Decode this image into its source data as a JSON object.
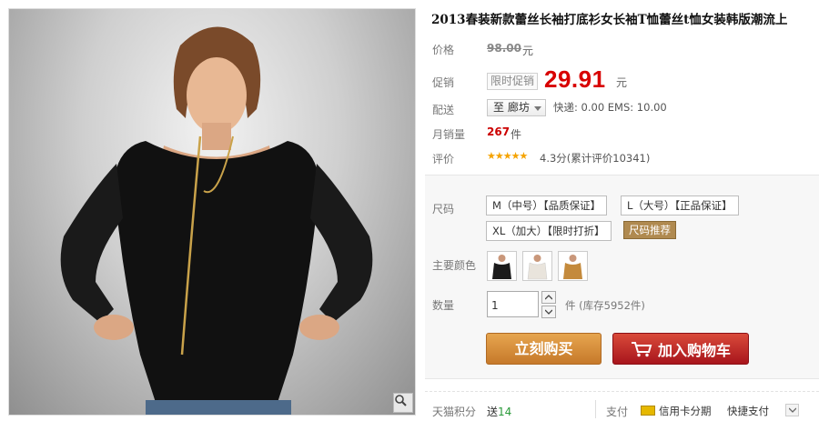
{
  "product": {
    "title": "2013春装新款蕾丝长袖打底衫女长袖T恤蕾丝t恤女装韩版潮流上"
  },
  "price": {
    "label": "价格",
    "original": "98.00",
    "unit": "元"
  },
  "promo": {
    "label": "促销",
    "tag": "限时促销",
    "price": "29.91",
    "unit": "元"
  },
  "delivery": {
    "label": "配送",
    "location": "至 廊坊",
    "shipping": "快递: 0.00 EMS: 10.00"
  },
  "sales": {
    "label": "月销量",
    "count": "267",
    "unit": "件"
  },
  "rating": {
    "label": "评价",
    "stars": "★★★★★",
    "text": "4.3分(累计评价10341)"
  },
  "sizes": {
    "label": "尺码",
    "options": [
      "M（中号）【品质保证】",
      "L（大号）【正品保证】",
      "XL（加大）【限时打折】"
    ],
    "recommend": "尺码推荐"
  },
  "colors": {
    "label": "主要颜色",
    "swatches": [
      "#1b1b1b",
      "#e9e4dc",
      "#c48a3c"
    ]
  },
  "quantity": {
    "label": "数量",
    "value": "1",
    "stock": "件 (库存5952件)"
  },
  "actions": {
    "buy": "立刻购买",
    "cart": "加入购物车"
  },
  "footer": {
    "points_label": "天猫积分",
    "points_prefix": "送",
    "points_value": "14",
    "payment_label": "支付",
    "payment_card": "信用卡分期",
    "payment_quick": "快捷支付"
  },
  "colors_theme": {
    "price_red": "#d80000",
    "buy_orange": "#d08a38",
    "cart_red": "#c0282a"
  }
}
